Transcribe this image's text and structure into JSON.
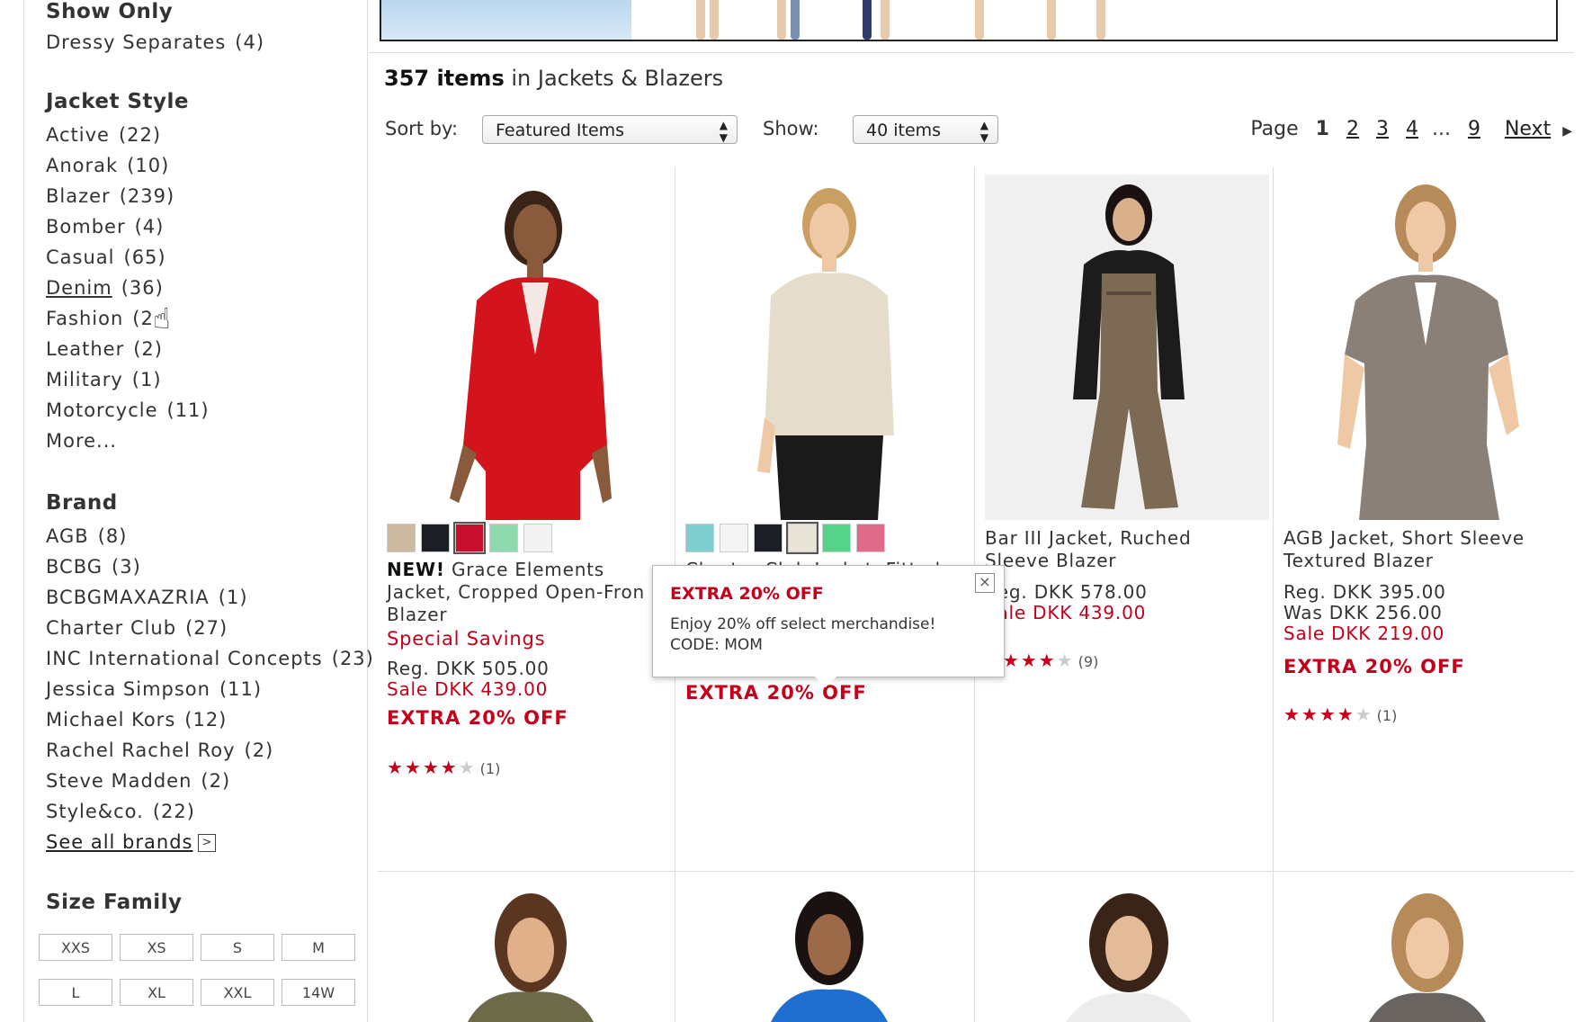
{
  "sidebar": {
    "show_only": {
      "title": "Show Only",
      "items": [
        {
          "label": "Dressy Separates",
          "count": "(4)"
        }
      ]
    },
    "jacket_style": {
      "title": "Jacket Style",
      "items": [
        {
          "label": "Active",
          "count": "(22)"
        },
        {
          "label": "Anorak",
          "count": "(10)"
        },
        {
          "label": "Blazer",
          "count": "(239)"
        },
        {
          "label": "Bomber",
          "count": "(4)"
        },
        {
          "label": "Casual",
          "count": "(65)"
        },
        {
          "label": "Denim",
          "count": "(36)"
        },
        {
          "label": "Fashion",
          "count": "(2"
        },
        {
          "label": "Leather",
          "count": "(2)"
        },
        {
          "label": "Military",
          "count": "(1)"
        },
        {
          "label": "Motorcycle",
          "count": "(11)"
        }
      ],
      "more": "More..."
    },
    "brand": {
      "title": "Brand",
      "items": [
        {
          "label": "AGB",
          "count": "(8)"
        },
        {
          "label": "BCBG",
          "count": "(3)"
        },
        {
          "label": "BCBGMAXAZRIA",
          "count": "(1)"
        },
        {
          "label": "Charter Club",
          "count": "(27)"
        },
        {
          "label": "INC International Concepts",
          "count": "(23)"
        },
        {
          "label": "Jessica Simpson",
          "count": "(11)"
        },
        {
          "label": "Michael Kors",
          "count": "(12)"
        },
        {
          "label": "Rachel Rachel Roy",
          "count": "(2)"
        },
        {
          "label": "Steve Madden",
          "count": "(2)"
        },
        {
          "label": "Style&co.",
          "count": "(22)"
        }
      ],
      "see_all": "See all brands",
      "see_all_icon": ">"
    },
    "size_family": {
      "title": "Size Family",
      "sizes": [
        "XXS",
        "XS",
        "S",
        "M",
        "L",
        "XL",
        "XXL",
        "14W"
      ]
    }
  },
  "results": {
    "count": "357 items",
    "category": "in Jackets & Blazers"
  },
  "sort": {
    "sort_label": "Sort by:",
    "sort_value": "Featured Items",
    "show_label": "Show:",
    "show_value": "40 items"
  },
  "pagination": {
    "page_label": "Page",
    "current": "1",
    "pages": [
      "2",
      "3",
      "4"
    ],
    "ellipsis": "...",
    "last": "9",
    "next": "Next"
  },
  "products": [
    {
      "badge": "NEW!",
      "title_line1": "Grace Elements",
      "title_line2": "Jacket, Cropped Open-Fron",
      "title_line3": "Blazer",
      "special": "Special Savings",
      "reg": "Reg. DKK 505.00",
      "sale": "Sale DKK 439.00",
      "extra": "EXTRA 20% OFF",
      "rating": "★★★★",
      "rating_off": "★",
      "reviews": "(1)",
      "swatches": [
        "#cdb9a0",
        "#1b1e24",
        "#c8102e",
        "#8fd9ae",
        "#f3f3f3"
      ]
    },
    {
      "title_line1": "Charter Club Jacket, Fitted",
      "extra": "EXTRA 20% OFF",
      "swatches": [
        "#7fcfcf",
        "#f4f4f4",
        "#1b1e24",
        "#e8e4d8",
        "#55d38a",
        "#e06a8a"
      ]
    },
    {
      "title_line1": "Bar III Jacket, Ruched",
      "title_line2": "Sleeve Blazer",
      "reg": "Reg. DKK 578.00",
      "sale": "Sale DKK 439.00",
      "rating": "★★★★",
      "rating_off": "★",
      "reviews": "(9)"
    },
    {
      "title_line1": "AGB Jacket, Short Sleeve",
      "title_line2": "Textured Blazer",
      "reg": "Reg. DKK 395.00",
      "was": "Was DKK 256.00",
      "sale": "Sale DKK 219.00",
      "extra": "EXTRA 20% OFF",
      "rating": "★★★★",
      "rating_off": "★",
      "reviews": "(1)"
    }
  ],
  "popup": {
    "title": "EXTRA 20% OFF",
    "line1": "Enjoy 20% off select merchandise!",
    "line2": "CODE: MOM",
    "close_icon": "×"
  },
  "colors": {
    "sale_red": "#c4001a",
    "border_gray": "#dddddd"
  }
}
